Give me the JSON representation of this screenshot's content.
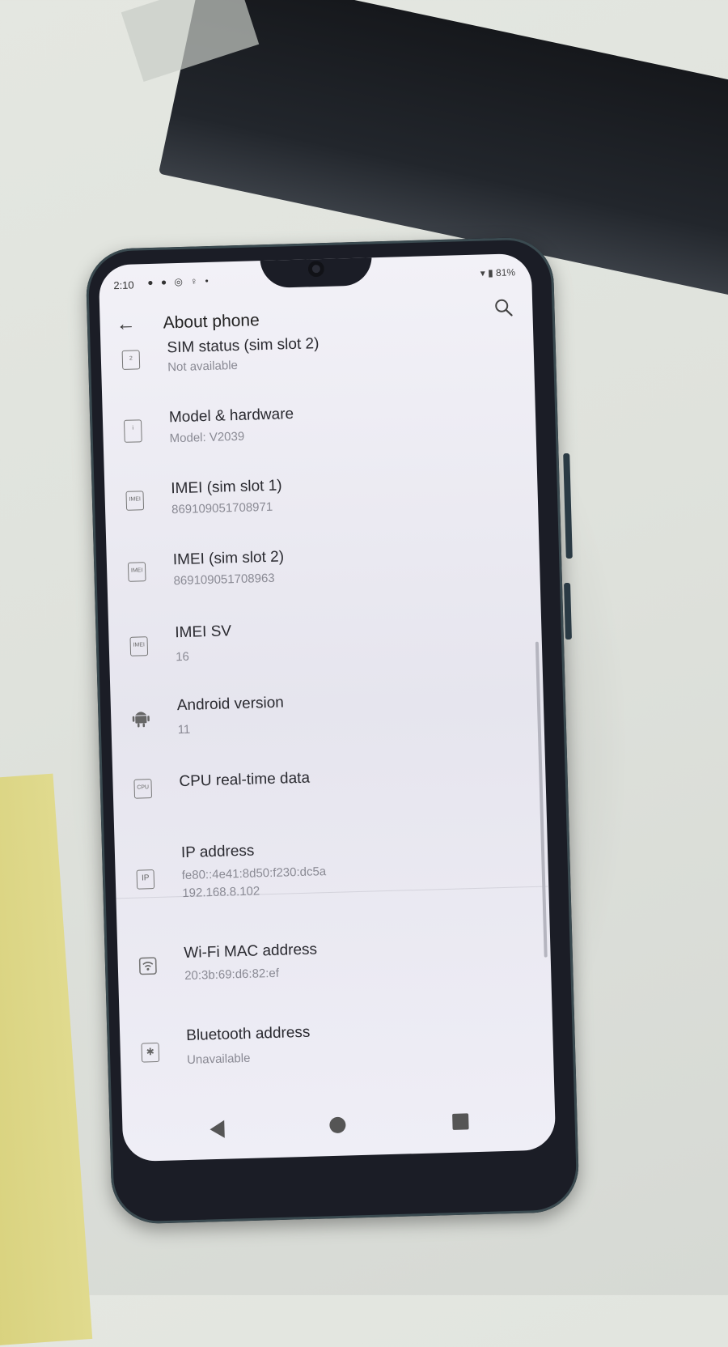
{
  "status_bar": {
    "time": "2:10",
    "left_icons": "● ● ◎ ♀ •",
    "right_text": "▾ ▮ 81%"
  },
  "toolbar": {
    "title": "About phone",
    "back_icon": "back-arrow-icon",
    "search_icon": "search-icon"
  },
  "items": [
    {
      "icon": "sim-card-icon",
      "icon_text": "2",
      "title": "SIM status (sim slot 2)",
      "subtitle": "Not available"
    },
    {
      "icon": "phone-info-icon",
      "icon_text": "i",
      "title": "Model & hardware",
      "subtitle": "Model: V2039"
    },
    {
      "icon": "imei-icon",
      "icon_text": "IMEI",
      "title": "IMEI (sim slot 1)",
      "subtitle": "869109051708971"
    },
    {
      "icon": "imei-icon",
      "icon_text": "IMEI",
      "title": "IMEI (sim slot 2)",
      "subtitle": "869109051708963"
    },
    {
      "icon": "imei-sv-icon",
      "icon_text": "IMEI",
      "title": "IMEI SV",
      "subtitle": "16"
    },
    {
      "icon": "android-icon",
      "icon_text": "",
      "title": "Android version",
      "subtitle": "11"
    },
    {
      "icon": "cpu-icon",
      "icon_text": "CPU",
      "title": "CPU real-time data",
      "subtitle": ""
    },
    {
      "icon": "ip-icon",
      "icon_text": "IP",
      "title": "IP address",
      "subtitle": "fe80::4e41:8d50:f230:dc5a",
      "subtitle2": "192.168.8.102"
    },
    {
      "icon": "wifi-icon",
      "icon_text": "",
      "title": "Wi-Fi MAC address",
      "subtitle": "20:3b:69:d6:82:ef"
    },
    {
      "icon": "bluetooth-icon",
      "icon_text": "✱",
      "title": "Bluetooth address",
      "subtitle": "Unavailable"
    }
  ],
  "nav_bar": {
    "back": "nav-back-icon",
    "home": "nav-home-icon",
    "recents": "nav-recents-icon"
  }
}
